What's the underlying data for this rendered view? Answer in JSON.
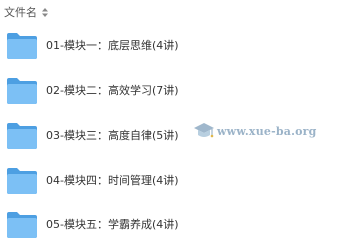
{
  "header": {
    "column_label": "文件名",
    "sort_icon": "sort-arrows-icon"
  },
  "files": [
    {
      "name": "01-模块一：底层思维(4讲)",
      "icon": "folder-icon"
    },
    {
      "name": "02-模块二：高效学习(7讲)",
      "icon": "folder-icon"
    },
    {
      "name": "03-模块三：高度自律(5讲)",
      "icon": "folder-icon"
    },
    {
      "name": "04-模块四：时间管理(4讲)",
      "icon": "folder-icon"
    },
    {
      "name": "05-模块五：学霸养成(4讲)",
      "icon": "folder-icon"
    }
  ],
  "watermark": {
    "text": "www.xue-ba.org",
    "icon": "graduation-cap-icon"
  },
  "colors": {
    "folder_back": "#4d9fe2",
    "folder_front": "#7cc0f5",
    "watermark": "#9bb3c8"
  }
}
